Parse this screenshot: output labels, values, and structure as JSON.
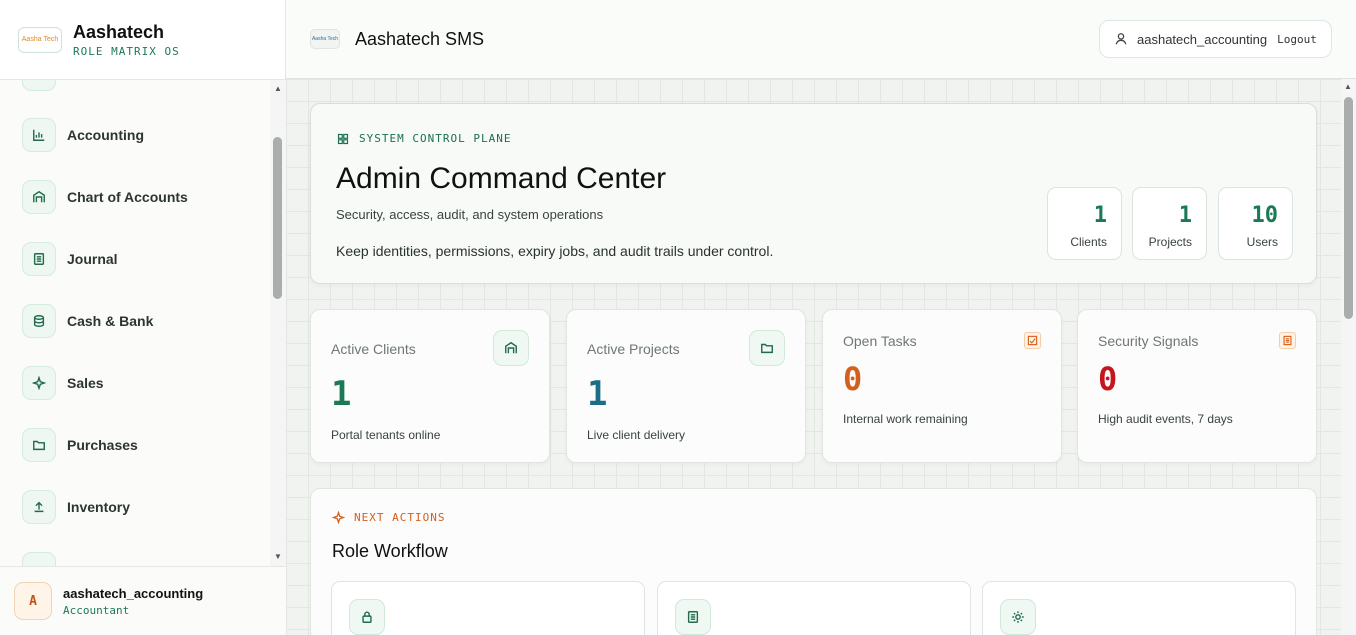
{
  "sidebar": {
    "brand_title": "Aashatech",
    "brand_sub": "ROLE MATRIX OS",
    "logo_text": "Aasha Tech",
    "items": [
      {
        "label": "Accounting",
        "icon": "bar-chart-icon"
      },
      {
        "label": "Chart of Accounts",
        "icon": "building-icon"
      },
      {
        "label": "Journal",
        "icon": "document-icon"
      },
      {
        "label": "Cash & Bank",
        "icon": "database-icon"
      },
      {
        "label": "Sales",
        "icon": "sparkle-icon"
      },
      {
        "label": "Purchases",
        "icon": "folder-icon"
      },
      {
        "label": "Inventory",
        "icon": "upload-icon"
      }
    ],
    "user": {
      "initial": "A",
      "name": "aashatech_accounting",
      "role": "Accountant"
    }
  },
  "header": {
    "logo_text": "Aasha Tech",
    "title": "Aashatech SMS",
    "username": "aashatech_accounting",
    "logout": "Logout"
  },
  "hero": {
    "eyebrow": "SYSTEM CONTROL PLANE",
    "title": "Admin Command Center",
    "subtitle": "Security, access, audit, and system operations",
    "description": "Keep identities, permissions, expiry jobs, and audit trails under control.",
    "stats": [
      {
        "value": "1",
        "label": "Clients"
      },
      {
        "value": "1",
        "label": "Projects"
      },
      {
        "value": "10",
        "label": "Users"
      }
    ]
  },
  "cards": [
    {
      "title": "Active Clients",
      "value": "1",
      "note": "Portal tenants online",
      "color": "#1b7a55"
    },
    {
      "title": "Active Projects",
      "value": "1",
      "note": "Live client delivery",
      "color": "#1a6f86"
    },
    {
      "title": "Open Tasks",
      "value": "0",
      "note": "Internal work remaining",
      "color": "#d2601e"
    },
    {
      "title": "Security Signals",
      "value": "0",
      "note": "High audit events, 7 days",
      "color": "#c4161c"
    }
  ],
  "actions": {
    "eyebrow": "NEXT ACTIONS",
    "title": "Role Workflow"
  }
}
